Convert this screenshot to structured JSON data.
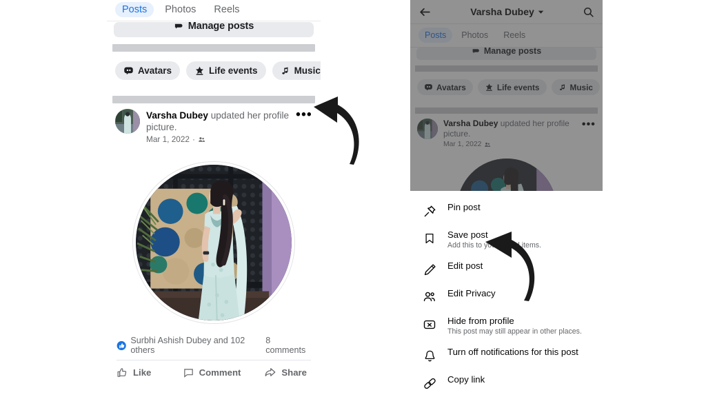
{
  "left_panel": {
    "tabs": [
      {
        "label": "Posts",
        "active": true
      },
      {
        "label": "Photos",
        "active": false
      },
      {
        "label": "Reels",
        "active": false
      }
    ],
    "manage_button": {
      "label": "Manage posts",
      "icon": "manage-posts-icon"
    },
    "chips": [
      {
        "label": "Avatars",
        "icon": "avatar-bubble-icon"
      },
      {
        "label": "Life events",
        "icon": "star-pedestal-icon"
      },
      {
        "label": "Music",
        "icon": "music-note-icon"
      }
    ],
    "post": {
      "author": "Varsha Dubey",
      "action_text": " updated her profile picture.",
      "date": "Mar 1, 2022",
      "separator": "·",
      "privacy_icon": "friends-icon",
      "more_icon": "more-options-icon",
      "photo_alt": "profile-photo"
    },
    "engagement": {
      "reaction_icon": "like-reaction-icon",
      "likes_text": "Surbhi Ashish Dubey and 102 others",
      "comments_text": "8 comments"
    },
    "actions": [
      {
        "label": "Like",
        "icon": "thumbs-up-icon"
      },
      {
        "label": "Comment",
        "icon": "comment-bubble-icon"
      },
      {
        "label": "Share",
        "icon": "share-arrow-icon"
      }
    ]
  },
  "right_panel": {
    "header": {
      "back_icon": "back-arrow-icon",
      "title": "Varsha Dubey",
      "caret_icon": "chevron-down-icon",
      "search_icon": "search-icon"
    },
    "tabs": [
      {
        "label": "Posts",
        "active": true
      },
      {
        "label": "Photos",
        "active": false
      },
      {
        "label": "Reels",
        "active": false
      }
    ],
    "manage_button": {
      "label": "Manage posts",
      "icon": "manage-posts-icon"
    },
    "chips": [
      {
        "label": "Avatars",
        "icon": "avatar-bubble-icon"
      },
      {
        "label": "Life events",
        "icon": "star-pedestal-icon"
      },
      {
        "label": "Music",
        "icon": "music-note-icon"
      }
    ],
    "post": {
      "author": "Varsha Dubey",
      "action_text": " updated her profile picture.",
      "date": "Mar 1, 2022",
      "separator": "·",
      "privacy_icon": "friends-icon",
      "more_icon": "more-options-icon"
    },
    "menu": [
      {
        "label": "Pin post",
        "sub": "",
        "icon": "pin-icon"
      },
      {
        "label": "Save post",
        "sub": "Add this to your saved items.",
        "icon": "bookmark-icon"
      },
      {
        "label": "Edit post",
        "sub": "",
        "icon": "pencil-icon"
      },
      {
        "label": "Edit Privacy",
        "sub": "",
        "icon": "people-icon"
      },
      {
        "label": "Hide from profile",
        "sub": "This post may still appear in other places.",
        "icon": "hide-x-icon"
      },
      {
        "label": "Turn off notifications for this post",
        "sub": "",
        "icon": "bell-icon"
      },
      {
        "label": "Copy link",
        "sub": "",
        "icon": "link-icon"
      }
    ]
  },
  "annotations": {
    "arrow_to_more_options": "curved-arrow-icon",
    "arrow_to_save_post": "curved-arrow-icon"
  },
  "colors": {
    "accent_blue": "#1b74e4",
    "active_tab_bg": "#e7f0fd",
    "chip_bg": "#e9eaed",
    "divider_gray": "#cdced1",
    "text_primary": "#050505",
    "text_secondary": "#65676b",
    "dim_overlay": "#3c3c3e"
  }
}
